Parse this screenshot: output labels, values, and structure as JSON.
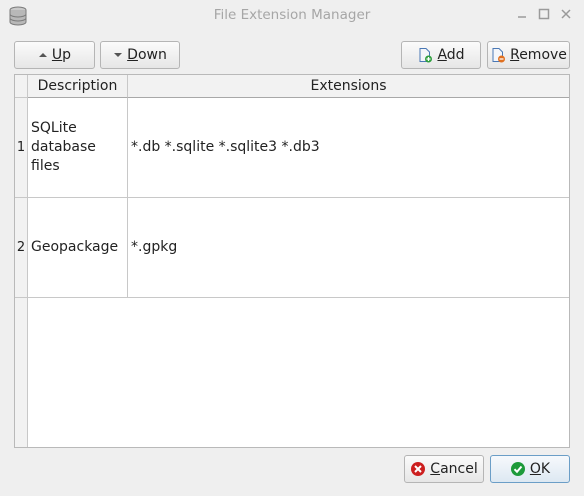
{
  "window": {
    "title": "File Extension Manager",
    "app_icon": "database-icon",
    "controls": [
      "minimize-icon",
      "maximize-icon",
      "close-icon"
    ]
  },
  "toolbar": {
    "up": {
      "mnemonic": "U",
      "rest": "p",
      "icon": "arrow-up-icon"
    },
    "down": {
      "mnemonic": "D",
      "rest": "own",
      "icon": "arrow-down-icon"
    },
    "add": {
      "mnemonic": "A",
      "rest": "dd",
      "icon": "add-file-icon"
    },
    "remove": {
      "mnemonic": "R",
      "rest": "emove",
      "icon": "remove-file-icon"
    }
  },
  "table": {
    "columns": [
      "Description",
      "Extensions"
    ],
    "rows": [
      {
        "num": "1",
        "description": "SQLite database files",
        "extensions": "*.db *.sqlite *.sqlite3 *.db3"
      },
      {
        "num": "2",
        "description": "Geopackage",
        "extensions": "*.gpkg"
      }
    ]
  },
  "footer": {
    "cancel": {
      "mnemonic": "C",
      "rest": "ancel",
      "icon": "cancel-icon"
    },
    "ok": {
      "mnemonic": "O",
      "rest": "K",
      "icon": "ok-check-icon"
    }
  },
  "colors": {
    "cancel_red": "#cc1f1f",
    "ok_green": "#1d9a3a",
    "accent_border": "#6b9ec7"
  }
}
